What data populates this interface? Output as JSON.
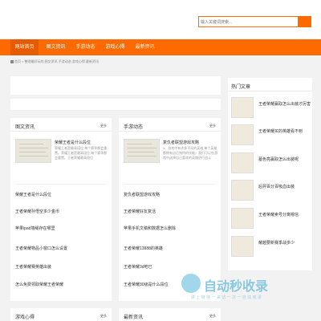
{
  "search": {
    "placeholder": "输入关键词搜索..."
  },
  "nav": {
    "items": [
      {
        "label": "网站首页",
        "active": true
      },
      {
        "label": "图文资讯",
        "active": false
      },
      {
        "label": "手游动态",
        "active": false
      },
      {
        "label": "游戏心得",
        "active": false
      },
      {
        "label": "最新资讯",
        "active": false
      }
    ]
  },
  "breadcrumb": {
    "text": "首页 > 整理最好玩的,图文资讯,手游动态,游戏心得,最新资讯"
  },
  "panels": {
    "news": {
      "title": "图文资讯",
      "more": "更多",
      "feature": {
        "title": "荣耀王者是什么段位",
        "desc": "荣耀王者是最高段位,每个赛季都会重置。荣耀王者是最高段位,每个赛季都会重置。王者荣耀最高段位"
      },
      "items": [
        "荣耀王者是什么段位",
        "王者荣耀孙悟空多少金币",
        "苹果ipad墙绳存在哪里",
        "王者荣耀物品小窗口怎么设置",
        "王者荣耀赛英雄出装",
        "怎么免费领取荣耀王者荣耀"
      ]
    },
    "mobile": {
      "title": "手游动态",
      "more": "更多",
      "feature": {
        "title": "复仇者联盟游戏攻略",
        "desc": "1、游戏中有许多不同的英雄,每个英雄都拥有自己独特的技能。我们可以在游戏中选择自己喜欢的英雄进行战斗"
      },
      "items": [
        "复仇者联盟游戏攻略",
        "王者荣耀好友复活",
        "苹果手机文稿和数据怎么删除",
        "王者荣耀13888的英雄",
        "王者荣耀3d吧已",
        "王者荣耀30级是什么段位"
      ]
    },
    "tips": {
      "title": "游戏心得",
      "more": "更多"
    },
    "latest": {
      "title": "最新资讯",
      "more": "更多"
    }
  },
  "hot": {
    "title": "热门文章",
    "items": [
      "王者荣耀赢取怎么出装才厉害",
      "王者荣耀买的英雄看不到",
      "墓色亮赢取怎么出装呢",
      "后羿百分百吸血出装",
      "王者荣耀卖号分离嗯信",
      "耀越要新赛季战多少"
    ]
  },
  "watermark": {
    "brand": "自动秒收录",
    "sub": "做 上 链 接 一 来 访 一 次 一 自 动 收 录"
  },
  "colors": {
    "accent": "#ff6a00",
    "nav_active": "#e65a00"
  }
}
